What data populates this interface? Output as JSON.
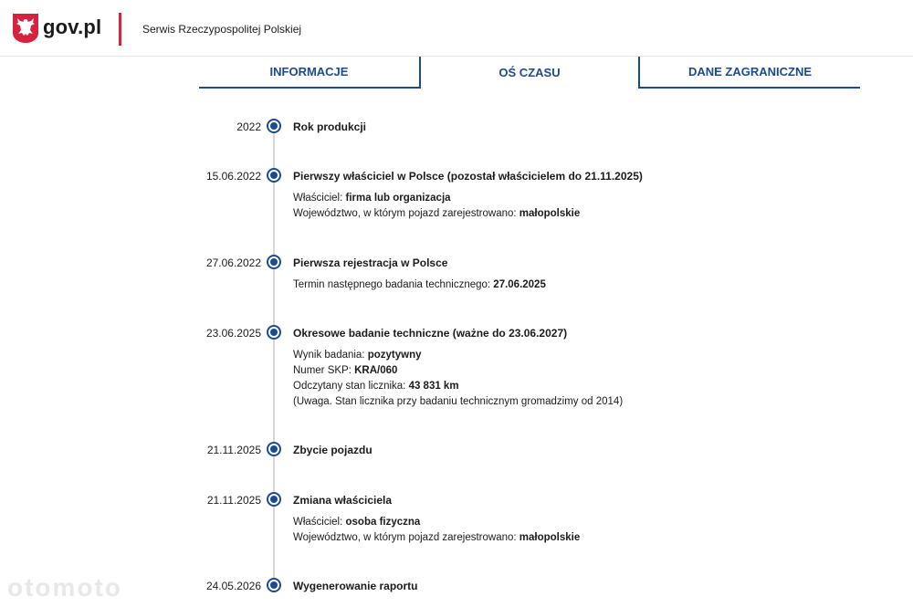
{
  "header": {
    "brand": "gov.pl",
    "service": "Serwis Rzeczypospolitej Polskiej",
    "accent_color": "#d5233f"
  },
  "tabs": [
    {
      "label": "INFORMACJE",
      "active": false
    },
    {
      "label": "OŚ CZASU",
      "active": true
    },
    {
      "label": "DANE ZAGRANICZNE",
      "active": false
    }
  ],
  "colors": {
    "primary": "#1c4a8f",
    "line": "#d7d7d7"
  },
  "timeline": [
    {
      "date": "2022",
      "title": "Rok produkcji"
    },
    {
      "date": "15.06.2022",
      "title": "Pierwszy właściciel w Polsce (pozostał właścicielem do 21.11.2025)",
      "d1_label": "Właściciel: ",
      "d1_value": "firma lub organizacja",
      "d2_label": "Województwo, w którym pojazd zarejestrowano: ",
      "d2_value": "małopolskie"
    },
    {
      "date": "27.06.2022",
      "title": "Pierwsza rejestracja w Polsce",
      "d1_label": "Termin następnego badania technicznego: ",
      "d1_value": "27.06.2025"
    },
    {
      "date": "23.06.2025",
      "title": "Okresowe badanie techniczne (ważne do 23.06.2027)",
      "d1_label": "Wynik badania: ",
      "d1_value": "pozytywny",
      "d2_label": "Numer SKP: ",
      "d2_value": "KRA/060",
      "d3_label": "Odczytany stan licznika: ",
      "d3_value": "43 831 km",
      "d4_label": "(Uwaga. Stan licznika przy badaniu technicznym gromadzimy od 2014)"
    },
    {
      "date": "21.11.2025",
      "title": "Zbycie pojazdu"
    },
    {
      "date": "21.11.2025",
      "title": "Zmiana właściciela",
      "d1_label": "Właściciel: ",
      "d1_value": "osoba fizyczna",
      "d2_label": "Województwo, w którym pojazd zarejestrowano: ",
      "d2_value": "małopolskie"
    },
    {
      "date": "24.05.2026",
      "title": "Wygenerowanie raportu"
    }
  ],
  "watermark": "otomoto"
}
